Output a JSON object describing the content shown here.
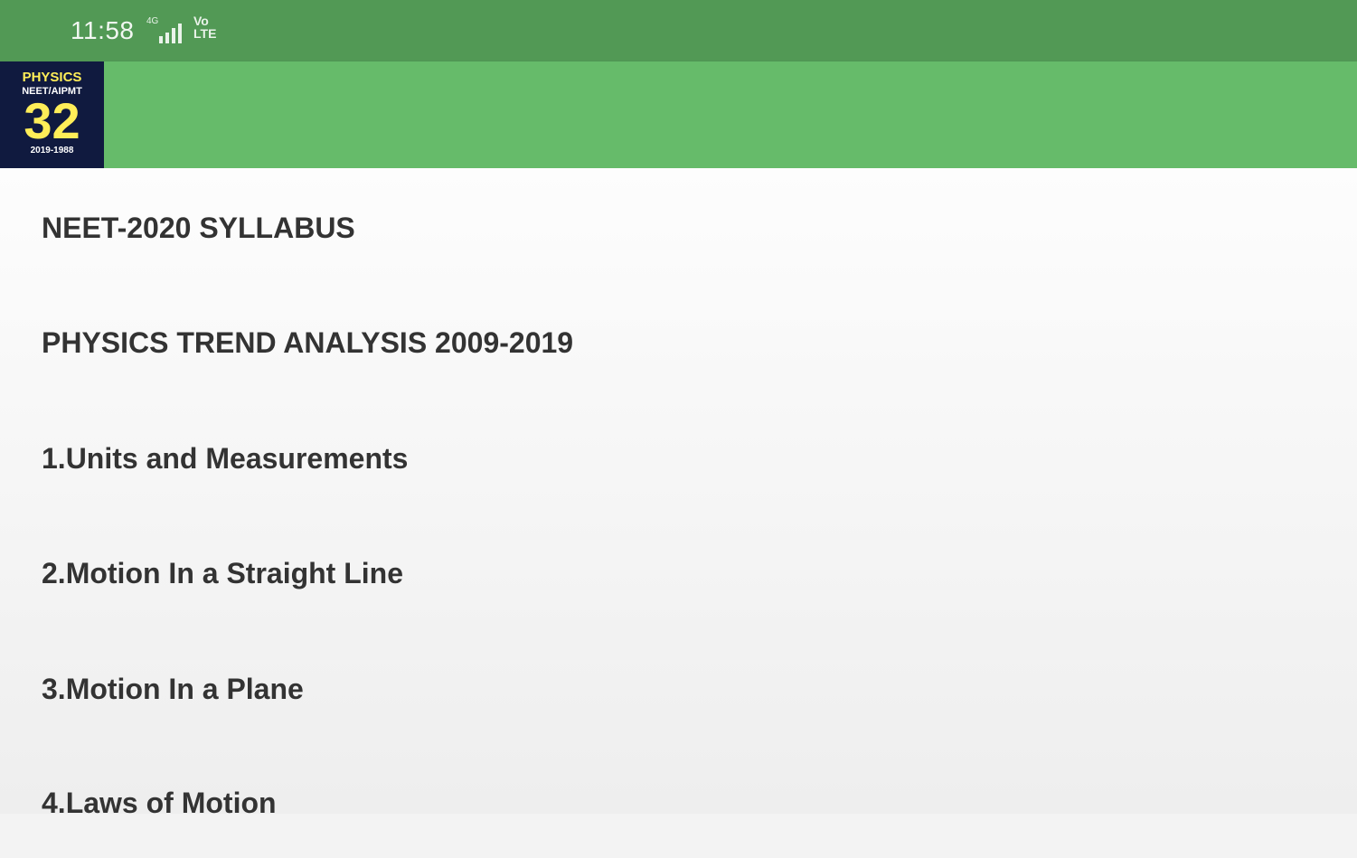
{
  "status_bar": {
    "time": "11:58",
    "network_badge": "4G",
    "volte_line1": "Vo",
    "volte_line2": "LTE",
    "signal_icon": "signal-bars-icon"
  },
  "toolbar": {
    "logo": {
      "top_text": "PHYSICS",
      "mid_text": "NEET/AIPMT",
      "number": "32",
      "years": "2019-1988"
    }
  },
  "list": {
    "items": [
      {
        "label": "NEET-2020 SYLLABUS"
      },
      {
        "label": "PHYSICS TREND ANALYSIS 2009-2019"
      },
      {
        "label": "1.Units and Measurements"
      },
      {
        "label": "2.Motion In a Straight Line"
      },
      {
        "label": "3.Motion In a Plane"
      },
      {
        "label": "4.Laws of Motion"
      }
    ]
  },
  "colors": {
    "status_bar": "#529955",
    "toolbar": "#66bb6a",
    "logo_bg": "#101a3f",
    "logo_accent": "#ffee58",
    "item_text": "#333333"
  }
}
